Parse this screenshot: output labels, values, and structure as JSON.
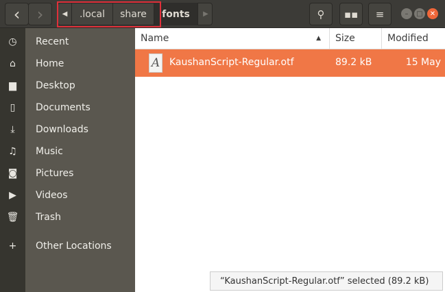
{
  "toolbar": {
    "back_icon": "‹",
    "forward_icon": "›",
    "path": [
      ".local",
      "share",
      "fonts"
    ],
    "search_icon": "search-icon",
    "view_icon": "grid-icon",
    "menu_icon": "menu-icon"
  },
  "sidebar": {
    "items": [
      {
        "label": "Recent",
        "icon": "◷"
      },
      {
        "label": "Home",
        "icon": "⌂"
      },
      {
        "label": "Desktop",
        "icon": "▆"
      },
      {
        "label": "Documents",
        "icon": "▯"
      },
      {
        "label": "Downloads",
        "icon": "⤓"
      },
      {
        "label": "Music",
        "icon": "♫"
      },
      {
        "label": "Pictures",
        "icon": "◙"
      },
      {
        "label": "Videos",
        "icon": "▶"
      },
      {
        "label": "Trash",
        "icon": "🗑"
      },
      {
        "label": "Other Locations",
        "icon": "+"
      }
    ]
  },
  "columns": {
    "name": "Name",
    "size": "Size",
    "modified": "Modified"
  },
  "files": [
    {
      "name": "KaushanScript-Regular.otf",
      "size": "89.2 kB",
      "modified": "15 May"
    }
  ],
  "status": "“KaushanScript-Regular.otf” selected  (89.2 kB)"
}
